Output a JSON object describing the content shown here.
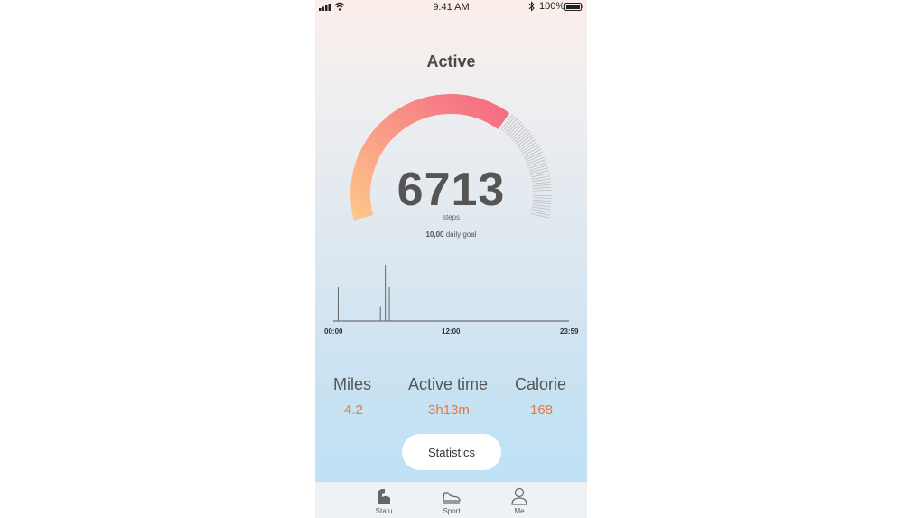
{
  "status_bar": {
    "time": "9:41 AM",
    "battery": "100%"
  },
  "title": "Active",
  "steps": {
    "value": "6713",
    "unit": "steps",
    "goal_number": "10,00",
    "goal_text": " daily goal"
  },
  "gauge": {
    "progress": 0.6713,
    "colors": {
      "start": "#fdc58a",
      "end": "#f56a84",
      "track": "#bdbdbd"
    }
  },
  "timeline": {
    "labels": [
      "00:00",
      "12:00",
      "23:59"
    ],
    "bars": [
      {
        "hour": 0.5,
        "level": 0.6
      },
      {
        "hour": 4.8,
        "level": 0.25
      },
      {
        "hour": 5.3,
        "level": 1.0
      },
      {
        "hour": 5.7,
        "level": 0.6
      }
    ]
  },
  "stats": [
    {
      "label": "Miles",
      "value": "4.2"
    },
    {
      "label": "Active time",
      "value": "3h13m"
    },
    {
      "label": "Calorie",
      "value": "168"
    }
  ],
  "statistics_button": "Statistics",
  "tabs": [
    {
      "label": "Statu",
      "icon": "muscle-icon"
    },
    {
      "label": "Sport",
      "icon": "shoe-icon"
    },
    {
      "label": "Me",
      "icon": "user-icon"
    }
  ]
}
